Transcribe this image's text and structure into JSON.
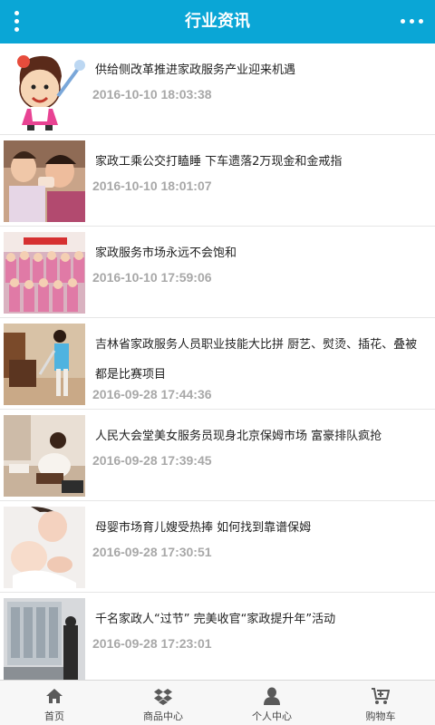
{
  "header": {
    "title": "行业资讯",
    "menu_icon": "vertical-dots-icon",
    "more_icon": "horizontal-dots-icon",
    "background_color": "#0aa6d6"
  },
  "articles": [
    {
      "title": "供给侧改革推进家政服务产业迎来机遇",
      "date": "2016-10-10 18:03:38"
    },
    {
      "title": "家政工乘公交打瞌睡 下车遗落2万现金和金戒指",
      "date": "2016-10-10 18:01:07"
    },
    {
      "title": "家政服务市场永远不会饱和",
      "date": "2016-10-10 17:59:06"
    },
    {
      "title": "吉林省家政服务人员职业技能大比拼 厨艺、熨烫、插花、叠被都是比赛项目",
      "date": "2016-09-28 17:44:36"
    },
    {
      "title": "人民大会堂美女服务员现身北京保姆市场 富豪排队疯抢",
      "date": "2016-09-28 17:39:45"
    },
    {
      "title": "母婴市场育儿嫂受热捧 如何找到靠谱保姆",
      "date": "2016-09-28 17:30:51"
    },
    {
      "title": "千名家政人“过节” 完美收官“家政提升年”活动",
      "date": "2016-09-28 17:23:01"
    }
  ],
  "tabbar": {
    "tabs": [
      {
        "label": "首页",
        "icon": "home-icon"
      },
      {
        "label": "商品中心",
        "icon": "dropbox-icon"
      },
      {
        "label": "个人中心",
        "icon": "user-icon"
      },
      {
        "label": "购物车",
        "icon": "cart-icon"
      }
    ]
  }
}
